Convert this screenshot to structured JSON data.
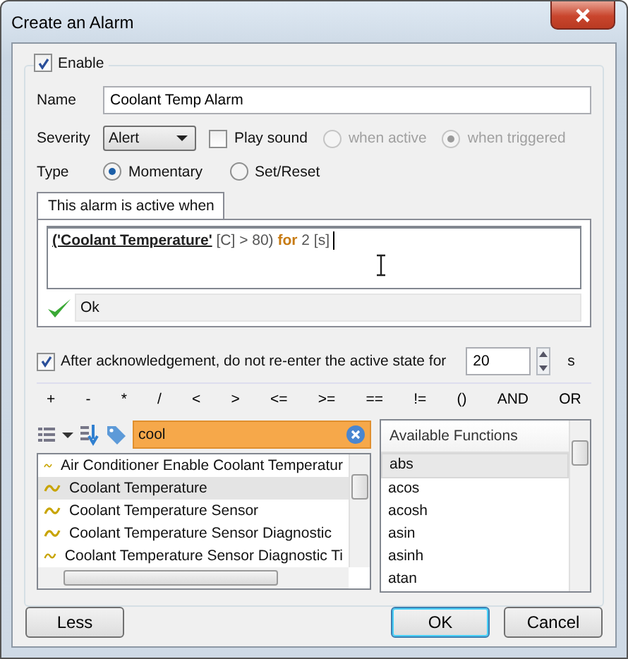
{
  "window": {
    "title": "Create an Alarm"
  },
  "enable": {
    "label": "Enable",
    "checked": true
  },
  "name": {
    "label": "Name",
    "value": "Coolant Temp Alarm"
  },
  "severity": {
    "label": "Severity",
    "value": "Alert"
  },
  "play_sound": {
    "label": "Play sound",
    "checked": false
  },
  "sound_options": [
    {
      "label": "when active",
      "selected": false,
      "disabled": true
    },
    {
      "label": "when triggered",
      "selected": true,
      "disabled": true
    }
  ],
  "type": {
    "label": "Type",
    "options": [
      {
        "label": "Momentary",
        "selected": true
      },
      {
        "label": "Set/Reset",
        "selected": false
      }
    ]
  },
  "condition_tab": {
    "label": "This alarm is active when"
  },
  "expression": [
    {
      "text": "('Coolant Temperature'",
      "kind": "signal"
    },
    {
      "text": "[C] > 80)",
      "kind": "plain"
    },
    {
      "text": "for",
      "kind": "keyword"
    },
    {
      "text": "2 [s]",
      "kind": "plain"
    }
  ],
  "validation": {
    "valid": true,
    "message": "Ok"
  },
  "rearm": {
    "checked": true,
    "label": "After acknowledgement, do not re-enter the active state for",
    "value": "20",
    "unit": "s"
  },
  "operators": [
    "+",
    "-",
    "*",
    "/",
    "<",
    ">",
    "<=",
    ">=",
    "==",
    "!=",
    "()",
    "AND",
    "OR"
  ],
  "search": {
    "value": "cool"
  },
  "signals": [
    {
      "label": "Air Conditioner Enable Coolant Temperatur",
      "selected": false
    },
    {
      "label": "Coolant Temperature",
      "selected": true
    },
    {
      "label": "Coolant Temperature Sensor",
      "selected": false
    },
    {
      "label": "Coolant Temperature Sensor Diagnostic",
      "selected": false
    },
    {
      "label": "Coolant Temperature Sensor Diagnostic Ti",
      "selected": false
    }
  ],
  "functions": {
    "header": "Available Functions",
    "items": [
      {
        "label": "abs",
        "selected": true
      },
      {
        "label": "acos",
        "selected": false
      },
      {
        "label": "acosh",
        "selected": false
      },
      {
        "label": "asin",
        "selected": false
      },
      {
        "label": "asinh",
        "selected": false
      },
      {
        "label": "atan",
        "selected": false
      }
    ]
  },
  "buttons": [
    {
      "label": "Less",
      "default": false
    },
    {
      "label": "OK",
      "default": true
    },
    {
      "label": "Cancel",
      "default": false
    }
  ]
}
